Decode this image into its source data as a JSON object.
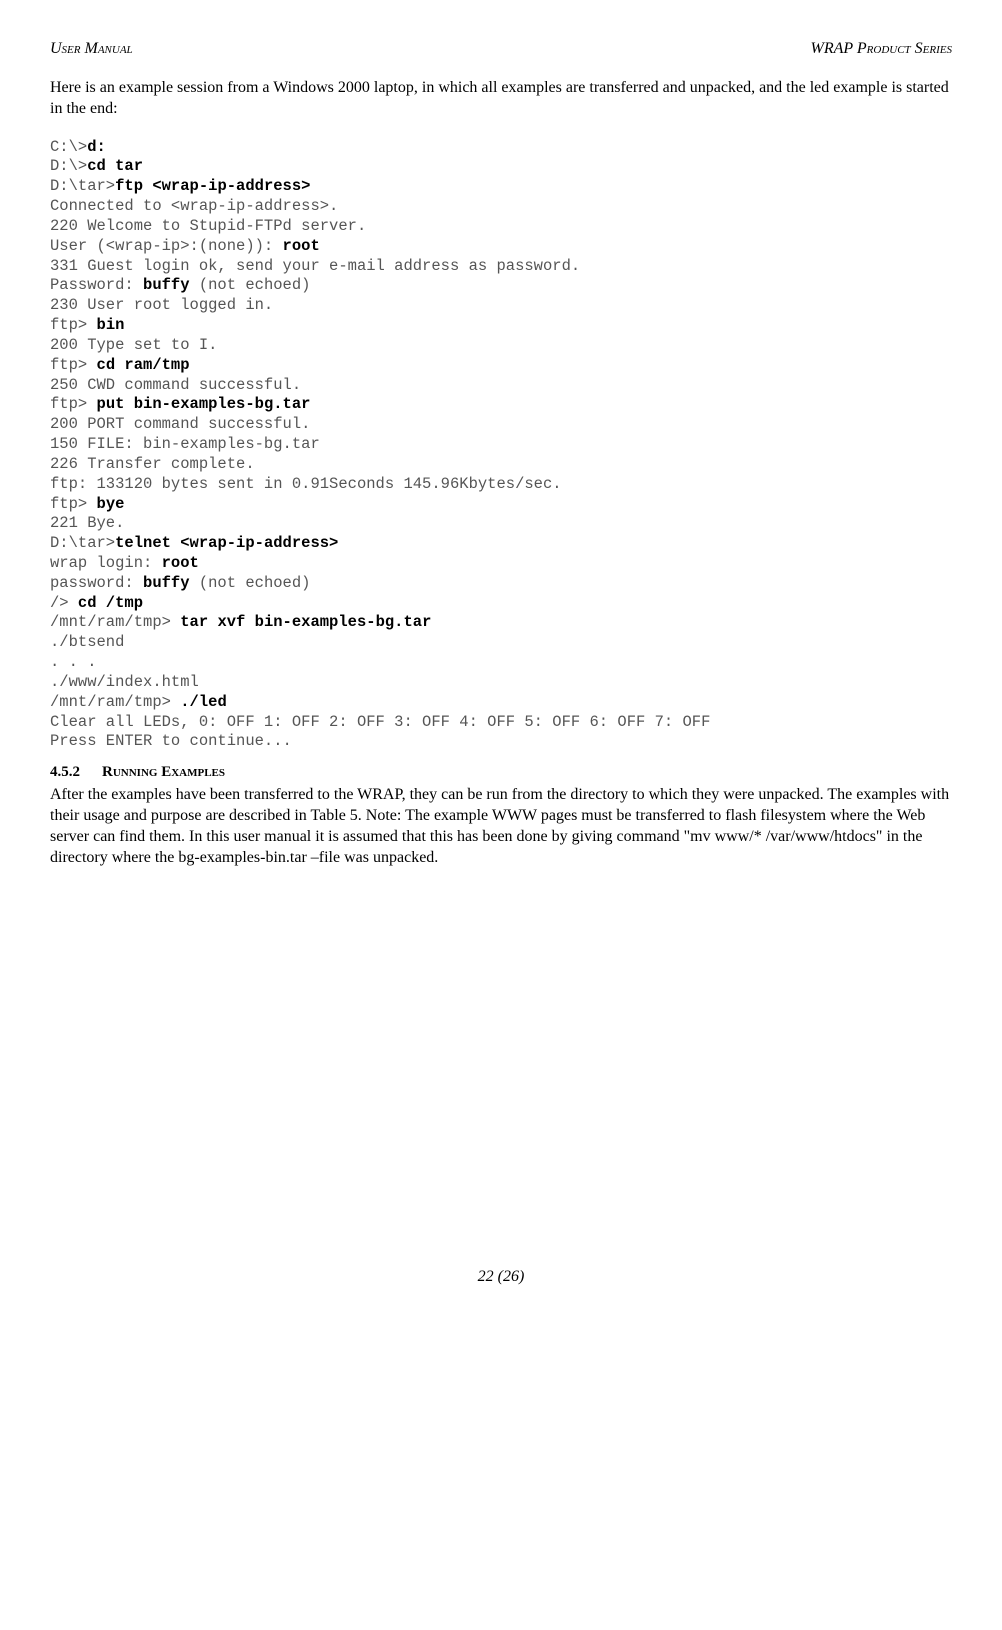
{
  "header": {
    "left": "User  Manual",
    "right": "WRAP Product Series"
  },
  "intro": "Here is an example session from a Windows 2000 laptop, in which all examples are transferred and unpacked, and the led example is started in the end:",
  "term": {
    "l01a": "C:\\>",
    "l01b": "d:",
    "l02a": "D:\\>",
    "l02b": "cd tar",
    "l03a": "D:\\tar>",
    "l03b": "ftp <wrap-ip-address>",
    "l04": "Connected to <wrap-ip-address>.",
    "l05": "220 Welcome to Stupid-FTPd server.",
    "l06a": "User (<wrap-ip>:(none)): ",
    "l06b": "root",
    "l07": "331 Guest login ok, send your e-mail address as password.",
    "l08a": "Password: ",
    "l08b": "buffy",
    "l08c": " (not echoed)",
    "l09": "230 User root logged in.",
    "l10a": "ftp> ",
    "l10b": "bin",
    "l11": "200 Type set to I.",
    "l12a": "ftp> ",
    "l12b": "cd ram/tmp",
    "l13": "250 CWD command successful.",
    "l14a": "ftp> ",
    "l14b": "put bin-examples-bg.tar",
    "l15": "200 PORT command successful.",
    "l16": "150 FILE: bin-examples-bg.tar",
    "l17": "226 Transfer complete.",
    "l18": "ftp: 133120 bytes sent in 0.91Seconds 145.96Kbytes/sec.",
    "l19a": "ftp> ",
    "l19b": "bye",
    "l20": "221 Bye.",
    "l21a": "D:\\tar>",
    "l21b": "telnet <wrap-ip-address>",
    "l22a": "wrap login: ",
    "l22b": "root",
    "l23a": "password: ",
    "l23b": "buffy",
    "l23c": " (not echoed)",
    "l24a": "/> ",
    "l24b": "cd /tmp",
    "l25a": "/mnt/ram/tmp> ",
    "l25b": "tar xvf bin-examples-bg.tar",
    "l26": "./btsend",
    "l27": ". . .",
    "l28": "./www/index.html",
    "l29a": "/mnt/ram/tmp> ",
    "l29b": "./led",
    "l30": "Clear all LEDs, 0: OFF 1: OFF 2: OFF 3: OFF 4: OFF 5: OFF 6: OFF 7: OFF",
    "l31": "Press ENTER to continue..."
  },
  "section": {
    "num": "4.5.2",
    "title": "Running Examples"
  },
  "body": "After the examples have been transferred to the WRAP, they can be run from the directory to which they were unpacked. The examples with their usage and purpose are described in Table 5. Note: The example WWW pages must be transferred to flash filesystem where the Web server can find them. In this user manual it is assumed that this has been done by giving command \"mv www/* /var/www/htdocs\" in the directory where the bg-examples-bin.tar –file was unpacked.",
  "footer": "22 (26)"
}
